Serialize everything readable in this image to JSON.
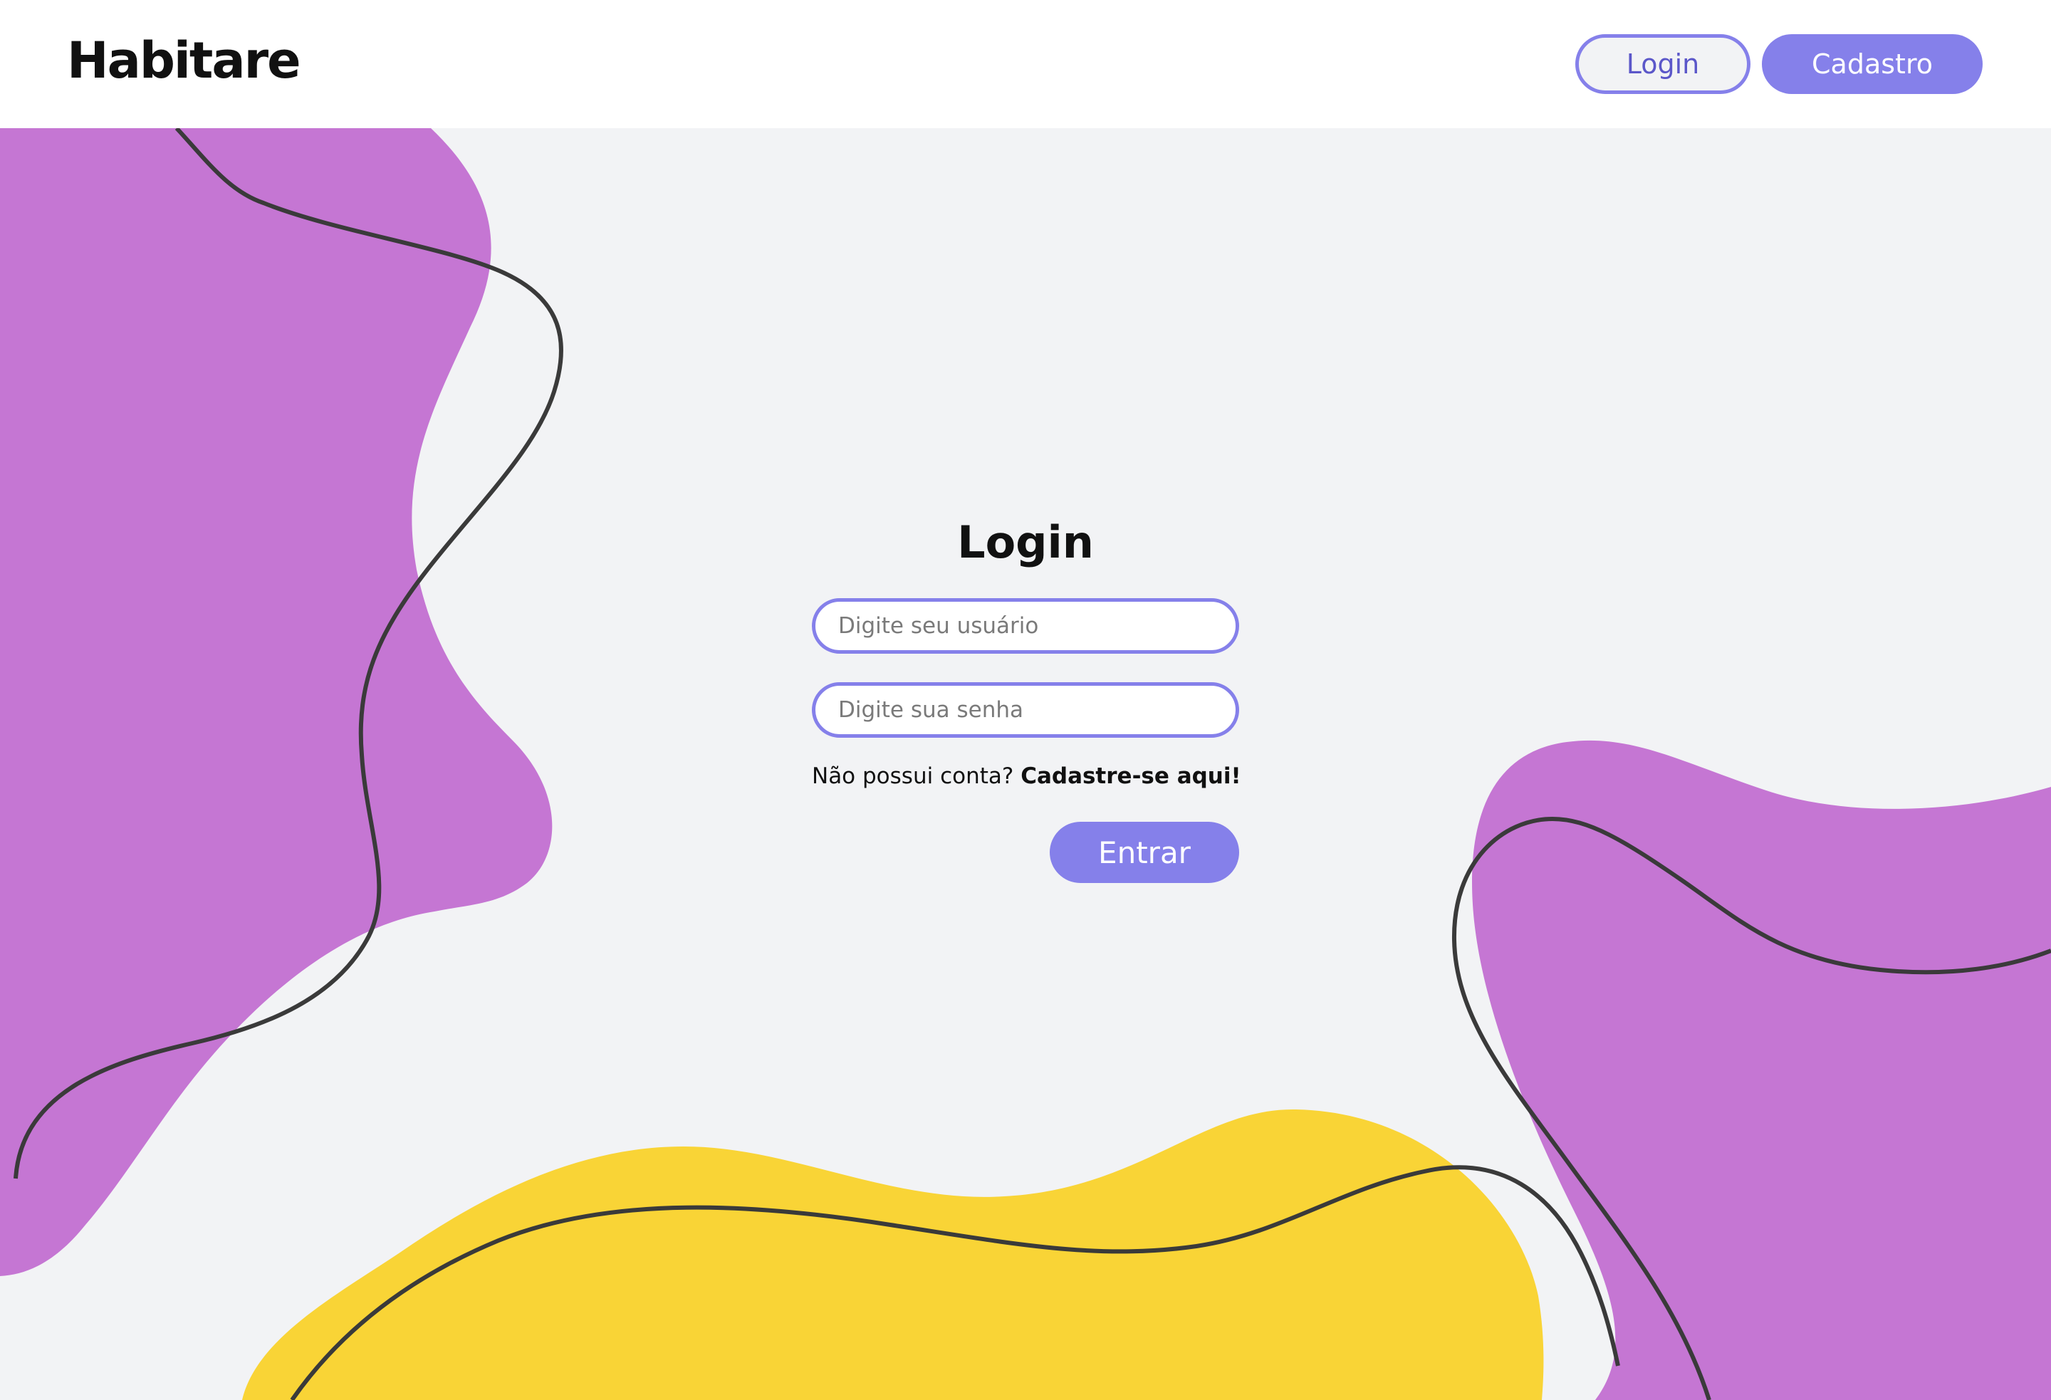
{
  "header": {
    "logo": "Habitare",
    "login_label": "Login",
    "signup_label": "Cadastro"
  },
  "form": {
    "title": "Login",
    "username_placeholder": "Digite seu usuário",
    "password_placeholder": "Digite sua senha",
    "no_account_text": "Não possui conta?",
    "signup_link": "Cadastre-se aqui!",
    "submit_label": "Entrar"
  },
  "colors": {
    "accent": "#8580ea",
    "purple_blob": "#c576d3",
    "yellow_blob": "#f9d436",
    "background": "#f2f3f5",
    "line": "#3a3a3a"
  }
}
